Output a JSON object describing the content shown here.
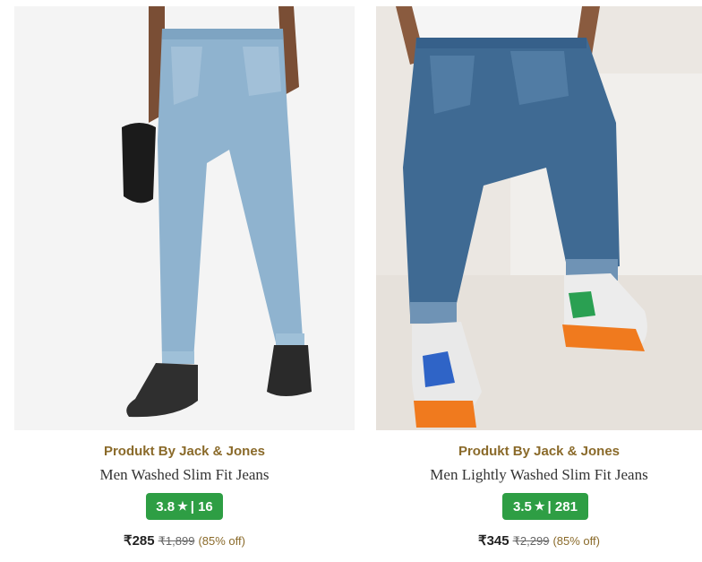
{
  "products": [
    {
      "brand": "Produkt By Jack & Jones",
      "name": "Men Washed Slim Fit Jeans",
      "rating": "3.8",
      "star_icon": "star-icon",
      "reviews_sep": "| 16",
      "price": "₹285",
      "mrp": "₹1,899",
      "discount": "(85% off)",
      "image": "man-in-light-blue-slim-jeans-holding-cap",
      "jeans_color": "#8fb3cf"
    },
    {
      "brand": "Produkt By Jack & Jones",
      "name": "Men Lightly Washed Slim Fit Jeans",
      "rating": "3.5",
      "star_icon": "star-icon",
      "reviews_sep": "| 281",
      "price": "₹345",
      "mrp": "₹2,299",
      "discount": "(85% off)",
      "image": "man-seated-in-dark-blue-jeans-with-sneakers",
      "jeans_color": "#3f6a93"
    }
  ],
  "colors": {
    "brand": "#8a6a2a",
    "rating_bg": "#2e9e44"
  }
}
